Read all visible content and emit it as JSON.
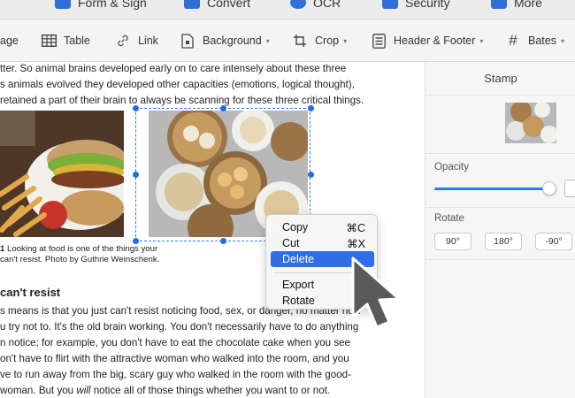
{
  "top_toolbar": {
    "items": [
      {
        "label": "Form & Sign",
        "icon": "form-sign-icon"
      },
      {
        "label": "Convert",
        "icon": "convert-icon"
      },
      {
        "label": "OCR",
        "icon": "ocr-icon"
      },
      {
        "label": "Security",
        "icon": "security-icon"
      },
      {
        "label": "More",
        "icon": "more-icon"
      }
    ]
  },
  "edit_toolbar": {
    "image_label": "age",
    "table_label": "Table",
    "link_label": "Link",
    "background_label": "Background",
    "crop_label": "Crop",
    "header_footer_label": "Header & Footer",
    "bates_label": "Bates"
  },
  "document": {
    "lines_top": [
      "tter. So animal brains developed early on to care intensely about these three",
      "s animals evolved they developed other capacities (emotions, logical thought),",
      "retained a part of their brain to always be scanning for these three critical things."
    ],
    "caption_bold": "1",
    "caption_line1": " Looking at food is one of the things your",
    "caption_line2": "can't resist. Photo by Guthrie Weinschenk.",
    "heading": "can't resist",
    "body_lines": [
      "s means is that you just can't resist noticing food, sex, or danger, no matter how",
      "u try not to. It's the old brain working. You don't necessarily have to do anything",
      "n notice; for example, you don't have to eat the chocolate cake when you see",
      "on't have to flirt with the attractive woman who walked into the room, and you",
      "ve to run away from the big, scary guy who walked in the room with the good-",
      "woman. But you "
    ],
    "body_last_italic": "will",
    "body_last_rest": " notice all of those things whether you want to or not."
  },
  "context_menu": {
    "copy": {
      "label": "Copy",
      "shortcut": "⌘C"
    },
    "cut": {
      "label": "Cut",
      "shortcut": "⌘X"
    },
    "delete": {
      "label": "Delete"
    },
    "export": {
      "label": "Export"
    },
    "rotate": {
      "label": "Rotate"
    }
  },
  "panel": {
    "title": "Stamp",
    "opacity_label": "Opacity",
    "opacity_value": 0.95,
    "rotate_label": "Rotate",
    "rotate_buttons": [
      "90°",
      "180°",
      "-90°"
    ]
  },
  "colors": {
    "accent": "#2f6ee4",
    "selection": "#1e6fe0"
  }
}
